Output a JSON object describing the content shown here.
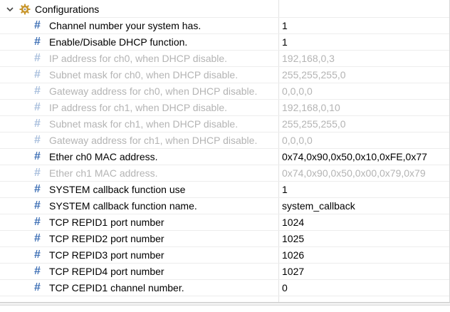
{
  "tree": {
    "root": {
      "label": "Configurations",
      "expand_icon": "chevron-down-icon",
      "icon": "gear-icon",
      "icon_color": "#c8962c"
    },
    "hash_color": "#3d6fb5",
    "disabled_color": "#b4b4b4",
    "rows": [
      {
        "label": "Channel number your system has.",
        "value": "1",
        "enabled": true
      },
      {
        "label": "Enable/Disable DHCP function.",
        "value": "1",
        "enabled": true
      },
      {
        "label": "IP address for ch0, when DHCP disable.",
        "value": "192,168,0,3",
        "enabled": false
      },
      {
        "label": "Subnet mask for ch0, when DHCP disable.",
        "value": "255,255,255,0",
        "enabled": false
      },
      {
        "label": "Gateway address for ch0, when DHCP disable.",
        "value": "0,0,0,0",
        "enabled": false
      },
      {
        "label": "IP address for ch1, when DHCP disable.",
        "value": "192,168,0,10",
        "enabled": false
      },
      {
        "label": "Subnet mask for ch1, when DHCP disable.",
        "value": "255,255,255,0",
        "enabled": false
      },
      {
        "label": "Gateway address for ch1, when DHCP disable.",
        "value": "0,0,0,0",
        "enabled": false
      },
      {
        "label": "Ether ch0 MAC address.",
        "value": "0x74,0x90,0x50,0x10,0xFE,0x77",
        "enabled": true
      },
      {
        "label": "Ether ch1 MAC address.",
        "value": "0x74,0x90,0x50,0x00,0x79,0x79",
        "enabled": false
      },
      {
        "label": "SYSTEM callback function use",
        "value": "1",
        "enabled": true
      },
      {
        "label": "SYSTEM callback function name.",
        "value": "system_callback",
        "enabled": true
      },
      {
        "label": "TCP REPID1 port number",
        "value": "1024",
        "enabled": true
      },
      {
        "label": "TCP REPID2 port number",
        "value": "1025",
        "enabled": true
      },
      {
        "label": "TCP REPID3 port number",
        "value": "1026",
        "enabled": true
      },
      {
        "label": "TCP REPID4 port number",
        "value": "1027",
        "enabled": true
      },
      {
        "label": "TCP CEPID1 channel number.",
        "value": "0",
        "enabled": true
      }
    ]
  }
}
